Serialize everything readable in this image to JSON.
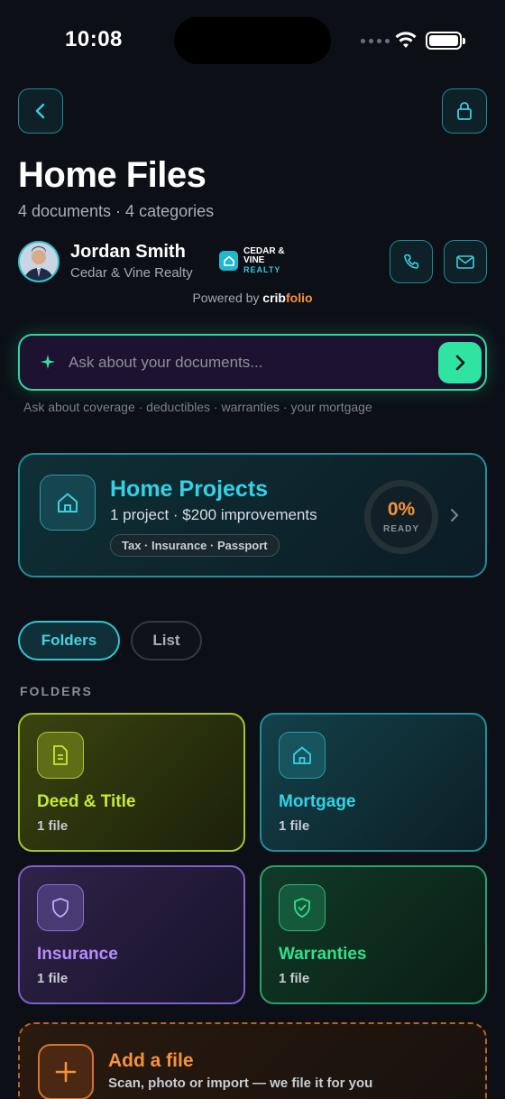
{
  "status_bar": {
    "time": "10:08"
  },
  "header": {
    "title": "Home Files",
    "subtitle": "4 documents · 4 categories"
  },
  "agent": {
    "name": "Jordan Smith",
    "company": "Cedar & Vine Realty",
    "brand_line1": "CEDAR &",
    "brand_line2": "VINE",
    "brand_line3": "REALTY"
  },
  "powered_by": {
    "prefix": "Powered by",
    "brand_a": "crib",
    "brand_b": "folio"
  },
  "ask": {
    "placeholder": "Ask about your documents...",
    "hint": "Ask about coverage · deductibles · warranties · your mortgage"
  },
  "projects": {
    "title": "Home Projects",
    "meta": "1 project · $200 improvements",
    "tags": "Tax · Insurance · Passport",
    "percent": "0%",
    "ready_label": "READY"
  },
  "view_toggle": {
    "folders": "Folders",
    "list": "List",
    "selected": "Folders"
  },
  "folders_section": {
    "label": "FOLDERS",
    "items": [
      {
        "name": "Deed & Title",
        "count": "1 file",
        "icon": "document-icon",
        "color": "#c5ec34"
      },
      {
        "name": "Mortgage",
        "count": "1 file",
        "icon": "house-icon",
        "color": "#33d3e6"
      },
      {
        "name": "Insurance",
        "count": "1 file",
        "icon": "shield-icon",
        "color": "#b48cff"
      },
      {
        "name": "Warranties",
        "count": "1 file",
        "icon": "shield-check-icon",
        "color": "#2fe08d"
      }
    ]
  },
  "add_file": {
    "title": "Add a file",
    "subtitle": "Scan, photo or import — we file it for you"
  },
  "colors": {
    "accent_teal": "#33d3e6",
    "accent_green": "#2fe3a0",
    "accent_orange": "#f7923a",
    "background": "#0c0f16"
  }
}
